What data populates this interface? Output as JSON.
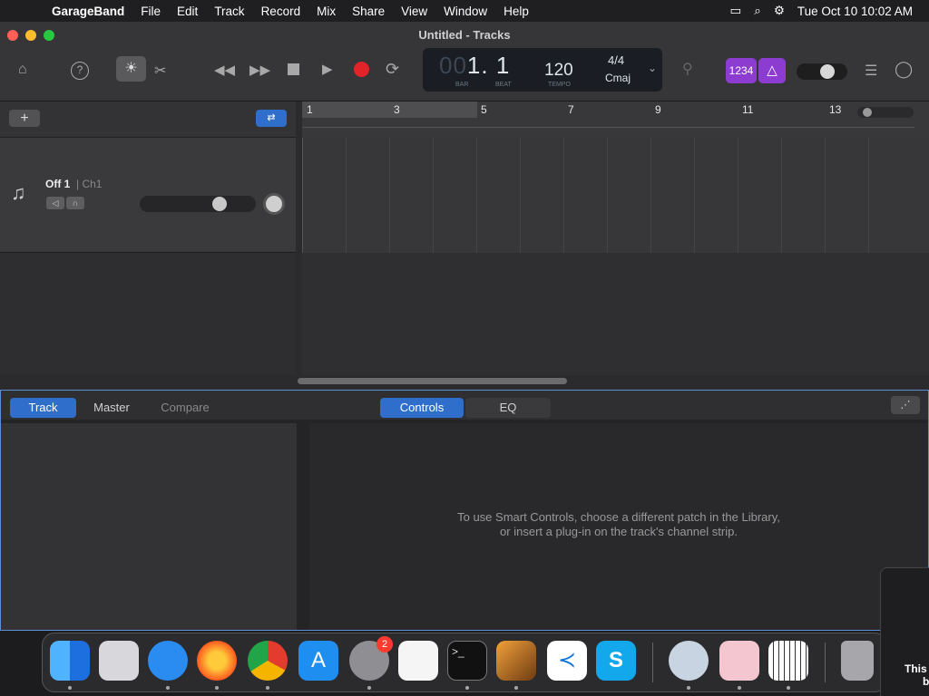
{
  "menubar": {
    "app": "GarageBand",
    "items": [
      "File",
      "Edit",
      "Track",
      "Record",
      "Mix",
      "Share",
      "View",
      "Window",
      "Help"
    ],
    "datetime": "Tue Oct 10  10:02 AM"
  },
  "window": {
    "title": "Untitled - Tracks"
  },
  "lcd": {
    "position_dim": "00",
    "position": "1. 1",
    "bar_label": "BAR",
    "beat_label": "BEAT",
    "tempo": "120",
    "tempo_label": "TEMPO",
    "signature": "4/4",
    "key": "Cmaj"
  },
  "toolbar": {
    "count_in": "1234"
  },
  "track": {
    "name": "Off 1",
    "channel": "| Ch1",
    "volume_level": 0.73
  },
  "ruler": {
    "bars": [
      "1",
      "3",
      "5",
      "7",
      "9",
      "11",
      "13"
    ]
  },
  "editor": {
    "tabs": [
      "Track",
      "Master",
      "Compare"
    ],
    "active_tab": "Track",
    "view_tabs": [
      "Controls",
      "EQ"
    ],
    "active_view_tab": "Controls",
    "message_line1": "To use Smart Controls, choose a different patch in the Library,",
    "message_line2": "or insert a plug-in on the track's channel strip."
  },
  "dock": {
    "apps": [
      "Finder",
      "Launchpad",
      "Safari",
      "Firefox",
      "Chrome",
      "App Store",
      "System Settings",
      "TextEdit",
      "Terminal",
      "GarageBand",
      "VS Code",
      "Skype",
      "QuickTime",
      "Pages",
      "Piano",
      "Trash"
    ],
    "settings_badge": "2"
  },
  "toast": {
    "text_line1": "This",
    "text_line2": "b"
  },
  "colors": {
    "accent": "#2f6fcb",
    "record": "#e0242a",
    "purple": "#8c3cd0"
  }
}
